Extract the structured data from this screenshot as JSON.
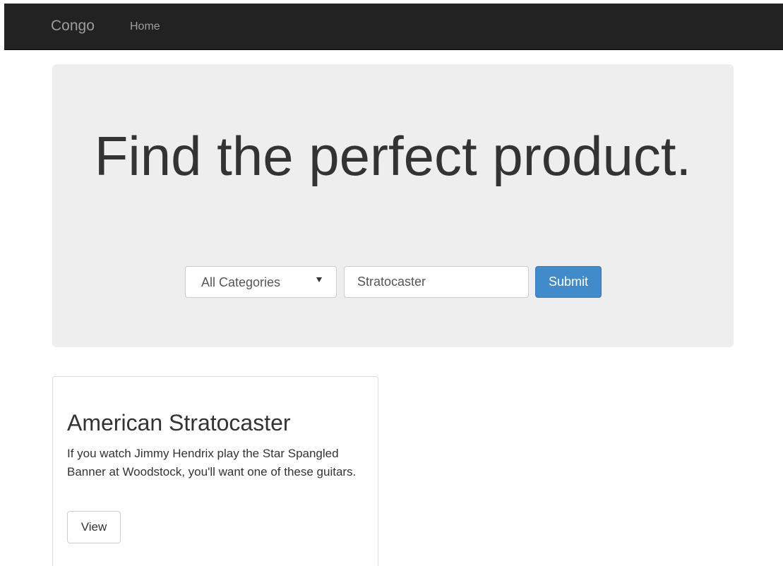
{
  "navbar": {
    "brand": "Congo",
    "links": [
      {
        "label": "Home"
      }
    ]
  },
  "hero": {
    "title": "Find the perfect product."
  },
  "search": {
    "category_selected": "All Categories",
    "query_value": "Stratocaster",
    "submit_label": "Submit"
  },
  "results": [
    {
      "title": "American Stratocaster",
      "description": "If you watch Jimmy Hendrix play the Star Spangled Banner at Woodstock, you'll want one of these guitars.",
      "view_label": "View"
    }
  ],
  "colors": {
    "navbar_bg": "#222222",
    "navbar_text": "#9d9d9d",
    "jumbotron_bg": "#eeeeee",
    "primary": "#428bca"
  }
}
